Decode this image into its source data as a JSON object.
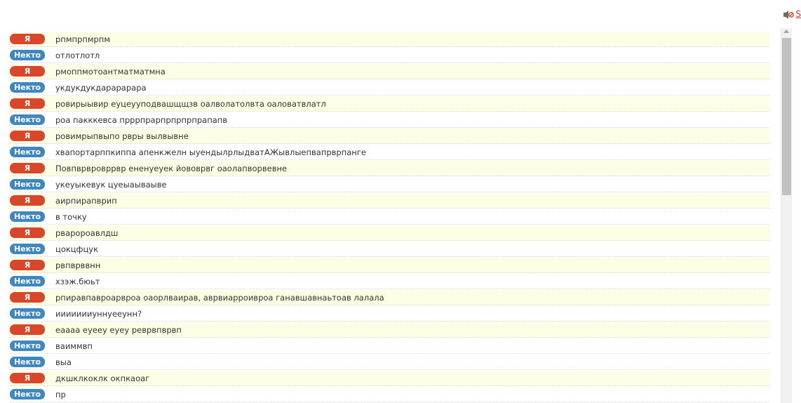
{
  "labels": {
    "me": "Я",
    "stranger": "Некто"
  },
  "toolbar": {
    "sound_icon": "speaker-muted-icon",
    "edge_glyph": "S"
  },
  "messages": [
    {
      "from": "me",
      "text": "рпмпрпмрпм"
    },
    {
      "from": "stranger",
      "text": "отлотлотл"
    },
    {
      "from": "me",
      "text": "рмоппмотоантматматмна"
    },
    {
      "from": "stranger",
      "text": "укдукдукдарарарара"
    },
    {
      "from": "me",
      "text": "ровирыывир еуцеууподвашщщзв оалволатолвта оаловатвлатл"
    },
    {
      "from": "stranger",
      "text": "роа пакккевса прррпрарпрпрпрпрапапв"
    },
    {
      "from": "me",
      "text": "ровимрыпвыпо рвры вылвывне"
    },
    {
      "from": "stranger",
      "text": "хвапортарппкиппа апенкжелн ыуендылрлыдватАЖывлыепвапрврпанге"
    },
    {
      "from": "me",
      "text": "Повпврвровррвр ененуеуек йововрвг оаолапворвевне"
    },
    {
      "from": "stranger",
      "text": "укеуыкевук цуеыаываыве"
    },
    {
      "from": "me",
      "text": "аирпирапврип"
    },
    {
      "from": "stranger",
      "text": "в точку"
    },
    {
      "from": "me",
      "text": "рваророавлдш"
    },
    {
      "from": "stranger",
      "text": "цокцфцук"
    },
    {
      "from": "me",
      "text": "рвпврввнн"
    },
    {
      "from": "stranger",
      "text": "хзэж.бюьт"
    },
    {
      "from": "me",
      "text": "рпиравпавроарвроа оаорлваирав, аврвиарроивроа ганавшавнаьтоав лалала"
    },
    {
      "from": "stranger",
      "text": "иииииииуннуееунн?"
    },
    {
      "from": "me",
      "text": "еаааа еуееу еуеу реврвпврвп"
    },
    {
      "from": "stranger",
      "text": "ваиммвп"
    },
    {
      "from": "stranger",
      "text": "выа"
    },
    {
      "from": "me",
      "text": "дкшклкоклк окпкаоаг"
    },
    {
      "from": "stranger",
      "text": "пр"
    }
  ]
}
